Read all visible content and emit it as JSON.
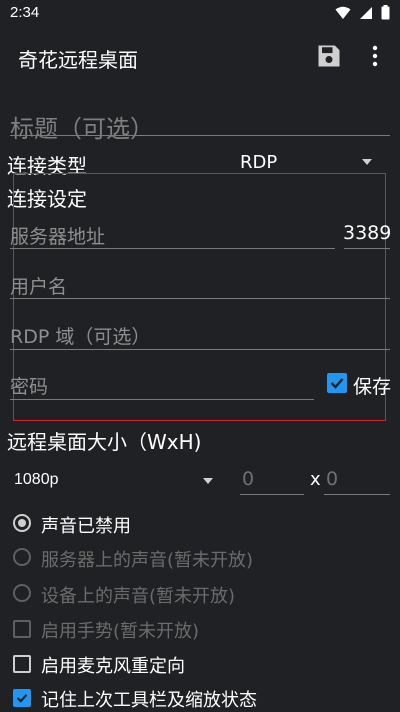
{
  "status_bar": {
    "time": "2:34"
  },
  "app_bar": {
    "title": "奇花远程桌面"
  },
  "form": {
    "title_placeholder": "标题（可选）",
    "connection_type_label": "连接类型",
    "connection_type_value": "RDP",
    "connection_settings_label": "连接设定",
    "server_placeholder": "服务器地址",
    "port_value": "3389",
    "username_placeholder": "用户名",
    "domain_placeholder": "RDP 域（可选）",
    "password_placeholder": "密码",
    "save_label": "保存",
    "save_checked": true,
    "desktop_size_label": "远程桌面大小（WxH)",
    "resolution_value": "1080p",
    "width_placeholder": "0",
    "size_separator": "x",
    "height_placeholder": "0"
  },
  "audio_options": [
    {
      "label": "声音已禁用",
      "checked": true,
      "enabled": true
    },
    {
      "label": "服务器上的声音(暂未开放)",
      "checked": false,
      "enabled": false
    },
    {
      "label": "设备上的声音(暂未开放)",
      "checked": false,
      "enabled": false
    }
  ],
  "checkbox_options": [
    {
      "label": "启用手势(暂未开放)",
      "checked": false,
      "enabled": false
    },
    {
      "label": "启用麦克风重定向",
      "checked": false,
      "enabled": true
    },
    {
      "label": "记住上次工具栏及缩放状态",
      "checked": true,
      "enabled": true
    }
  ],
  "colors": {
    "background": "#202124",
    "accent": "#2196f3",
    "highlight_box": "#d3262b"
  }
}
